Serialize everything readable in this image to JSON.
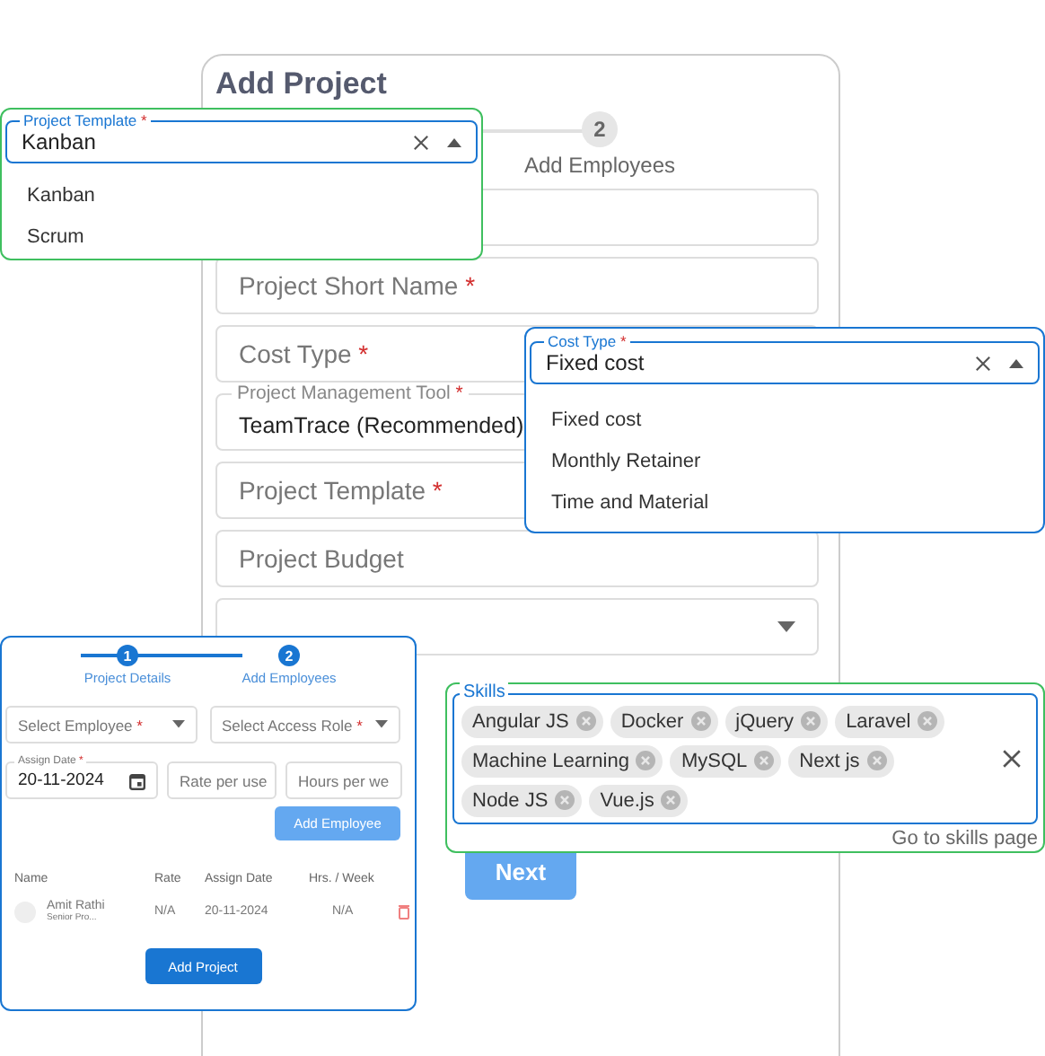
{
  "main_form": {
    "title": "Add Project",
    "stepper": {
      "steps": [
        {
          "number": "2",
          "label": "Add Employees",
          "selected": false
        }
      ]
    },
    "fields": [
      {
        "kind": "text"
      },
      {
        "kind": "text",
        "placeholder": "Project Short Name",
        "mark": "*"
      },
      {
        "kind": "text",
        "placeholder": "Cost Type",
        "mark": "*"
      },
      {
        "kind": "filled",
        "label": "Project Management Tool",
        "mark": "*",
        "value": "TeamTrace (Recommended)"
      },
      {
        "kind": "text",
        "placeholder": "Project Template",
        "mark": "*"
      },
      {
        "kind": "text",
        "placeholder": "Project Budget"
      },
      {
        "kind": "select"
      }
    ],
    "next_button": {
      "label": "Next",
      "disabled": true
    }
  },
  "template_dropdown": {
    "label": "Project Template",
    "mark": "*",
    "value": "Kanban",
    "options": [
      "Kanban",
      "Scrum"
    ]
  },
  "cost_type_dropdown": {
    "label": "Cost Type",
    "mark": "*",
    "value": "Fixed cost",
    "options": [
      "Fixed cost",
      "Monthly Retainer",
      "Time and Material"
    ]
  },
  "skills": {
    "label": "Skills",
    "chips": [
      "Angular JS",
      "Docker",
      "jQuery",
      "Laravel",
      "Machine Learning",
      "MySQL",
      "Next js",
      "Node JS",
      "Vue.js"
    ],
    "link": "Go to skills page"
  },
  "employee_panel": {
    "stepper": [
      {
        "number": "1",
        "label": "Project Details"
      },
      {
        "number": "2",
        "label": "Add Employees"
      }
    ],
    "selects": [
      {
        "placeholder": "Select Employee",
        "mark": "*"
      },
      {
        "placeholder": "Select Access Role",
        "mark": "*"
      }
    ],
    "assign_date": {
      "label": "Assign Date",
      "mark": "*",
      "value": "20-11-2024"
    },
    "rate": {
      "placeholder": "Rate per use"
    },
    "hours": {
      "placeholder": "Hours per we"
    },
    "add_employee_button": {
      "label": "Add Employee",
      "disabled": true
    },
    "table": {
      "columns": [
        "Name",
        "Rate",
        "Assign Date",
        "Hrs. / Week"
      ],
      "rows": [
        {
          "name": "Amit Rathi",
          "role": "Senior Pro...",
          "rate": "N/A",
          "assign_date": "20-11-2024",
          "hours": "N/A"
        }
      ]
    },
    "add_project_button": {
      "label": "Add Project",
      "disabled": false
    }
  }
}
